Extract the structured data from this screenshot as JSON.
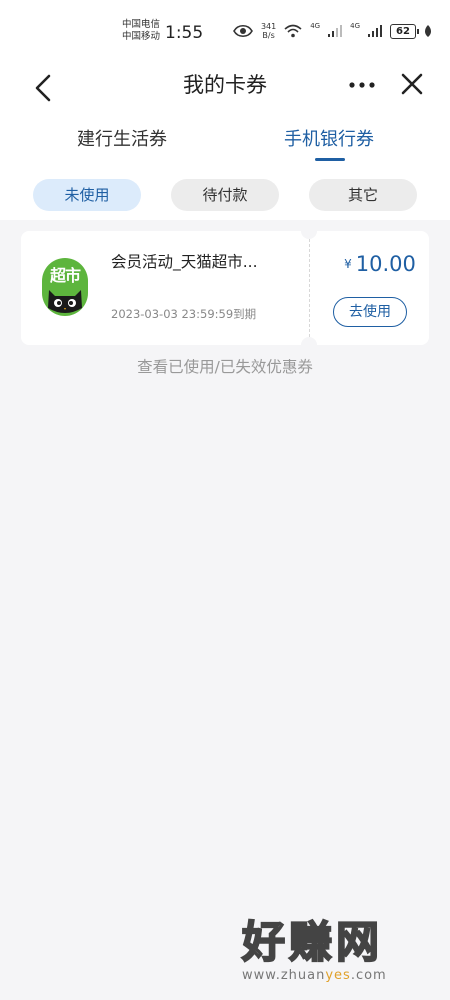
{
  "status_bar": {
    "carrier_1": "中国电信",
    "carrier_2": "中国移动",
    "time": "1:55",
    "net_speed_value": "341",
    "net_speed_unit": "B/s",
    "signal_1_type": "4G",
    "signal_2_type": "4G",
    "battery": "62",
    "icons": [
      "eye-icon",
      "wifi-icon",
      "signal-icon",
      "signal-icon",
      "battery-icon",
      "leaf-icon"
    ]
  },
  "header": {
    "title": "我的卡券",
    "back_icon": "chevron-left-icon",
    "more_icon": "more-dots-icon",
    "close_icon": "close-icon"
  },
  "tabs": [
    {
      "label": "建行生活券",
      "active": false
    },
    {
      "label": "手机银行券",
      "active": true
    }
  ],
  "filters": [
    {
      "label": "未使用",
      "active": true
    },
    {
      "label": "待付款",
      "active": false
    },
    {
      "label": "其它",
      "active": false
    }
  ],
  "coupons": [
    {
      "name": "会员活动_天猫超市...",
      "logo_text": "超市",
      "logo_icon": "tmall-supermarket-logo",
      "expiry": "2023-03-03 23:59:59到期",
      "currency": "¥",
      "amount": "10.00",
      "action_label": "去使用"
    }
  ],
  "history_link": "查看已使用/已失效优惠券",
  "watermark": {
    "big_text": "好赚网",
    "url_prefix": "www.zhuan",
    "url_highlight": "yes",
    "url_suffix": ".com"
  },
  "colors": {
    "accent": "#1f5fa3",
    "active_chip_bg": "#dcebfb",
    "page_bg": "#f5f5f7",
    "logo_green": "#5db53d"
  }
}
